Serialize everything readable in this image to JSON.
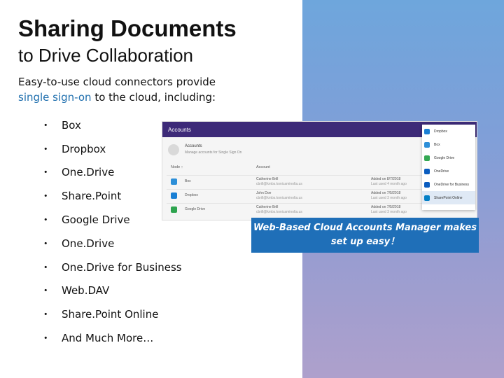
{
  "slide": {
    "title": "Sharing Documents",
    "subtitle": "to Drive Collaboration",
    "intro_line1": "Easy-to-use cloud connectors provide",
    "intro_highlight": "single sign-on",
    "intro_line2_rest": " to the cloud, including:",
    "bullet_glyph": "•",
    "bullets": [
      "Box",
      "Dropbox",
      "One.Drive",
      "Share.Point",
      "Google Drive",
      "One.Drive",
      "One.Drive for Business",
      "Web.DAV",
      "Share.Point Online",
      "And Much More…"
    ],
    "caption": "Web-Based Cloud Accounts Manager makes set up easy！"
  },
  "screenshot": {
    "app_bar_title": "Accounts",
    "header_title": "Accounts",
    "header_subtitle": "Manage accounts for Single Sign On",
    "col_node": "Node ↑",
    "col_account": "Account",
    "rows": [
      {
        "name": "Box",
        "user": "Catherine Brill",
        "email": "cbrill@kmbs.konicaminolta.us",
        "date": "Added on 8/7/2018",
        "last": "Last used 4 month ago",
        "color": "#2d8fd8"
      },
      {
        "name": "Dropbox",
        "user": "John Doe",
        "email": "cbrill@kmbs.konicaminolta.us",
        "date": "Added on 7/5/2018",
        "last": "Last used 3 month ago",
        "color": "#1a7fd4"
      },
      {
        "name": "Google Drive",
        "user": "Catherine Brill",
        "email": "cbrill@kmbs.konicaminolta.us",
        "date": "Added on 7/5/2018",
        "last": "Last used 3 month ago",
        "color": "#2ea44f"
      }
    ],
    "menu": [
      {
        "label": "Dropbox",
        "color": "#1a7fd4"
      },
      {
        "label": "Box",
        "color": "#2d8fd8"
      },
      {
        "label": "Google Drive",
        "color": "#34a853"
      },
      {
        "label": "OneDrive",
        "color": "#0a5cbf"
      },
      {
        "label": "OneDrive for Business",
        "color": "#0a5cbf"
      },
      {
        "label": "SharePoint Online",
        "color": "#037fc6"
      }
    ]
  },
  "colors": {
    "accent_blue": "#1f6fb8",
    "highlight_text": "#1f6fae",
    "app_bar": "#3d2a78"
  }
}
